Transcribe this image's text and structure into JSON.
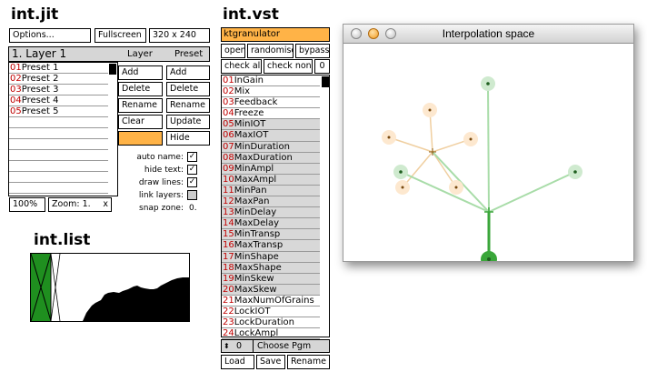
{
  "headings": {
    "jit": "int.jit",
    "list": "int.list",
    "vst": "int.vst"
  },
  "jit": {
    "options": "Options...",
    "fullscreen": "Fullscreen",
    "resolution": "320 x 240",
    "layer_title": "1. Layer 1",
    "presets": [
      {
        "num": "01",
        "name": "Preset 1"
      },
      {
        "num": "02",
        "name": "Preset 2"
      },
      {
        "num": "03",
        "name": "Preset 3"
      },
      {
        "num": "04",
        "name": "Preset 4"
      },
      {
        "num": "05",
        "name": "Preset 5"
      }
    ],
    "layer_header": "Layer",
    "preset_header": "Preset",
    "layer_buttons": [
      "Add",
      "Delete",
      "Rename",
      "Clear"
    ],
    "preset_buttons": [
      "Add",
      "Delete",
      "Rename",
      "Update",
      "Hide"
    ],
    "options_list": [
      {
        "label": "auto name:",
        "checked": true
      },
      {
        "label": "hide text:",
        "checked": true
      },
      {
        "label": "draw lines:",
        "checked": true
      },
      {
        "label": "link layers:",
        "checked": false
      }
    ],
    "snap_label": "snap zone:",
    "snap_value": "0.",
    "zoom_percent": "100%",
    "zoom_label": "Zoom: 1.",
    "zoom_close": "x",
    "accent": "#ffb347"
  },
  "vst": {
    "plugin": "ktgranulator",
    "buttons": [
      "open",
      "randomise",
      "bypass"
    ],
    "check_all": "check all",
    "check_none": "check none",
    "count": "0",
    "params": [
      {
        "num": "01",
        "name": "InGain",
        "checked": false
      },
      {
        "num": "02",
        "name": "Mix",
        "checked": false
      },
      {
        "num": "03",
        "name": "Feedback",
        "checked": false
      },
      {
        "num": "04",
        "name": "Freeze",
        "checked": false
      },
      {
        "num": "05",
        "name": "MinIOT",
        "checked": true
      },
      {
        "num": "06",
        "name": "MaxIOT",
        "checked": true
      },
      {
        "num": "07",
        "name": "MinDuration",
        "checked": true
      },
      {
        "num": "08",
        "name": "MaxDuration",
        "checked": true
      },
      {
        "num": "09",
        "name": "MinAmpl",
        "checked": true
      },
      {
        "num": "10",
        "name": "MaxAmpl",
        "checked": true
      },
      {
        "num": "11",
        "name": "MinPan",
        "checked": true
      },
      {
        "num": "12",
        "name": "MaxPan",
        "checked": true
      },
      {
        "num": "13",
        "name": "MinDelay",
        "checked": true
      },
      {
        "num": "14",
        "name": "MaxDelay",
        "checked": true
      },
      {
        "num": "15",
        "name": "MinTransp",
        "checked": true
      },
      {
        "num": "16",
        "name": "MaxTransp",
        "checked": true
      },
      {
        "num": "17",
        "name": "MinShape",
        "checked": true
      },
      {
        "num": "18",
        "name": "MaxShape",
        "checked": true
      },
      {
        "num": "19",
        "name": "MinSkew",
        "checked": true
      },
      {
        "num": "20",
        "name": "MaxSkew",
        "checked": true
      },
      {
        "num": "21",
        "name": "MaxNumOfGrains",
        "checked": false
      },
      {
        "num": "22",
        "name": "LockIOT",
        "checked": false
      },
      {
        "num": "23",
        "name": "LockDuration",
        "checked": false
      },
      {
        "num": "24",
        "name": "LockAmpl",
        "checked": false
      }
    ],
    "pgm_number": "0",
    "choose_pgm": "Choose Pgm",
    "bottom_buttons": [
      "Load",
      "Save",
      "Rename"
    ],
    "accent": "#ffb347"
  },
  "window": {
    "title": "Interpolation space",
    "green": "#3aa63a",
    "orange": "#f5c07a"
  }
}
